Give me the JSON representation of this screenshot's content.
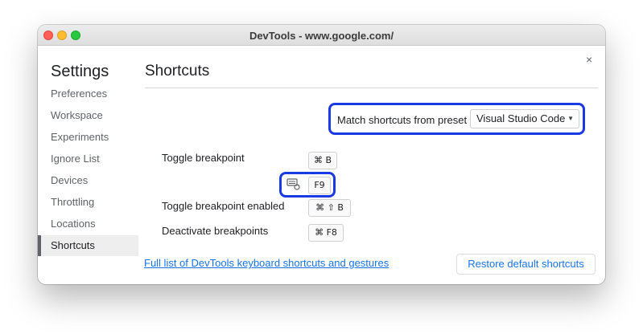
{
  "window": {
    "title": "DevTools - www.google.com/"
  },
  "close_label": "×",
  "sidebar": {
    "title": "Settings",
    "items": [
      {
        "label": "Preferences"
      },
      {
        "label": "Workspace"
      },
      {
        "label": "Experiments"
      },
      {
        "label": "Ignore List"
      },
      {
        "label": "Devices"
      },
      {
        "label": "Throttling"
      },
      {
        "label": "Locations"
      },
      {
        "label": "Shortcuts",
        "active": true
      }
    ]
  },
  "main": {
    "title": "Shortcuts",
    "preset": {
      "label": "Match shortcuts from preset",
      "selected": "Visual Studio Code"
    },
    "shortcuts": [
      {
        "label": "Toggle breakpoint",
        "keys": [
          "⌘ B",
          "F9"
        ]
      },
      {
        "label": "Toggle breakpoint enabled",
        "keys": [
          "⌘ ⇧ B"
        ]
      },
      {
        "label": "Deactivate breakpoints",
        "keys": [
          "⌘ F8"
        ]
      }
    ],
    "footer_link": "Full list of DevTools keyboard shortcuts and gestures",
    "restore_button": "Restore default shortcuts"
  },
  "colors": {
    "highlight": "#1a3be3",
    "link": "#1a73e8"
  },
  "icons": {
    "edit_shortcut": "keyboard-edit-icon",
    "close": "close-icon"
  }
}
